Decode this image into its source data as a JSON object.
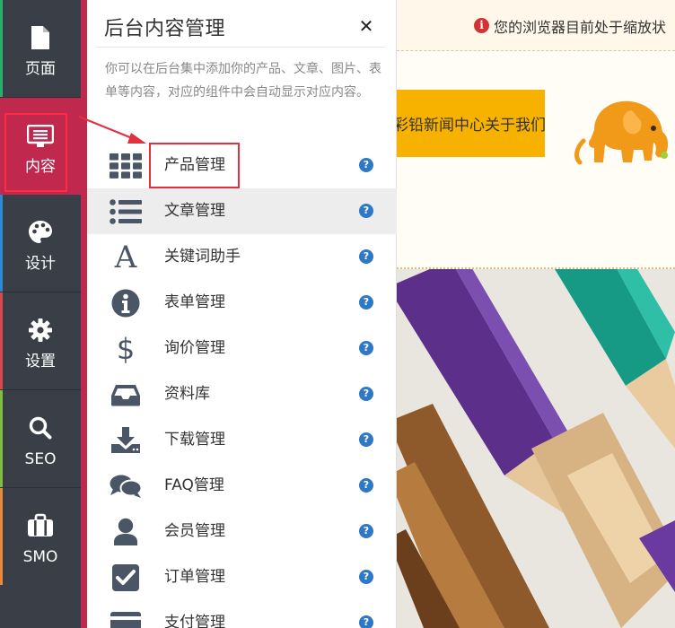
{
  "rail": {
    "items": [
      {
        "key": "page",
        "label": "页面",
        "icon": "page-icon",
        "accent": "#27b06b"
      },
      {
        "key": "content",
        "label": "内容",
        "icon": "content-icon",
        "accent": "#c0284e"
      },
      {
        "key": "design",
        "label": "设计",
        "icon": "palette-icon",
        "accent": "#2a8ad6"
      },
      {
        "key": "settings",
        "label": "设置",
        "icon": "gear-icon",
        "accent": "#d9474a"
      },
      {
        "key": "seo",
        "label": "SEO",
        "icon": "search-icon",
        "accent": "#7fbf3f"
      },
      {
        "key": "smo",
        "label": "SMO",
        "icon": "briefcase-icon",
        "accent": "#e88a3a"
      }
    ],
    "active": "content"
  },
  "panel": {
    "title": "后台内容管理",
    "close_icon": "close-icon",
    "description": "你可以在后台集中添加你的产品、文章、图片、表单等内容，对应的组件中会自动显示对应内容。",
    "help_glyph": "?",
    "items": [
      {
        "label": "产品管理",
        "icon": "grid-icon",
        "highlighted": true
      },
      {
        "label": "文章管理",
        "icon": "list-icon",
        "hovered": true
      },
      {
        "label": "关键词助手",
        "icon": "font-a-icon"
      },
      {
        "label": "表单管理",
        "icon": "info-icon"
      },
      {
        "label": "询价管理",
        "icon": "dollar-icon"
      },
      {
        "label": "资料库",
        "icon": "inbox-icon"
      },
      {
        "label": "下载管理",
        "icon": "download-icon"
      },
      {
        "label": "FAQ管理",
        "icon": "chat-icon"
      },
      {
        "label": "会员管理",
        "icon": "user-icon"
      },
      {
        "label": "订单管理",
        "icon": "checkbox-icon"
      },
      {
        "label": "支付管理",
        "icon": "credit-card-icon"
      }
    ]
  },
  "preview": {
    "notice_glyph": "i",
    "notice": "您的浏览器目前处于缩放状",
    "nav_text": "彩铅新闻中心关于我们",
    "colors": {
      "nav_bar": "#f7b200",
      "logo": "#f19a1a",
      "accent_red": "#e2303f"
    }
  }
}
